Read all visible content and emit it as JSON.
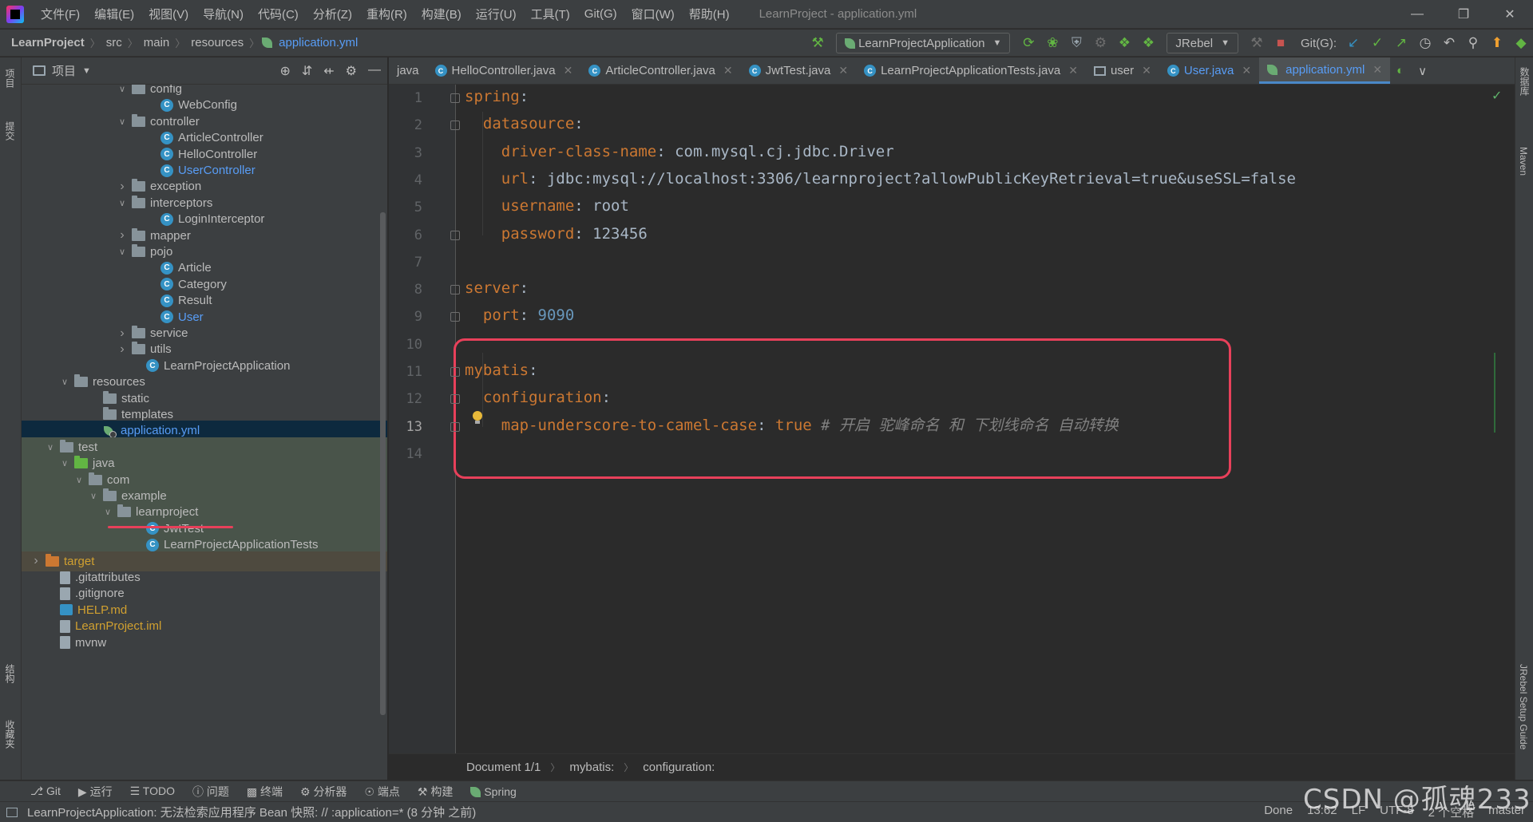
{
  "menu": {
    "items": [
      "文件(F)",
      "编辑(E)",
      "视图(V)",
      "导航(N)",
      "代码(C)",
      "分析(Z)",
      "重构(R)",
      "构建(B)",
      "运行(U)",
      "工具(T)",
      "Git(G)",
      "窗口(W)",
      "帮助(H)"
    ],
    "window_title": "LearnProject - application.yml"
  },
  "navbar": {
    "crumbs": [
      "LearnProject",
      "src",
      "main",
      "resources",
      "application.yml"
    ],
    "run_config": "LearnProjectApplication",
    "jrebel": "JRebel",
    "git_label": "Git(G):"
  },
  "project_panel": {
    "title": "项目"
  },
  "tree": [
    {
      "label": "config",
      "indent": 7,
      "expanded": true,
      "icon": "folder"
    },
    {
      "label": "WebConfig",
      "indent": 9,
      "icon": "class"
    },
    {
      "label": "controller",
      "indent": 7,
      "expanded": true,
      "icon": "folder"
    },
    {
      "label": "ArticleController",
      "indent": 9,
      "icon": "class"
    },
    {
      "label": "HelloController",
      "indent": 9,
      "icon": "class"
    },
    {
      "label": "UserController",
      "indent": 9,
      "icon": "class",
      "color": "blue"
    },
    {
      "label": "exception",
      "indent": 7,
      "expanded": false,
      "icon": "folder"
    },
    {
      "label": "interceptors",
      "indent": 7,
      "expanded": true,
      "icon": "folder"
    },
    {
      "label": "LoginInterceptor",
      "indent": 9,
      "icon": "class"
    },
    {
      "label": "mapper",
      "indent": 7,
      "expanded": false,
      "icon": "folder"
    },
    {
      "label": "pojo",
      "indent": 7,
      "expanded": true,
      "icon": "folder"
    },
    {
      "label": "Article",
      "indent": 9,
      "icon": "class"
    },
    {
      "label": "Category",
      "indent": 9,
      "icon": "class"
    },
    {
      "label": "Result",
      "indent": 9,
      "icon": "class"
    },
    {
      "label": "User",
      "indent": 9,
      "icon": "class",
      "color": "blue"
    },
    {
      "label": "service",
      "indent": 7,
      "expanded": false,
      "icon": "folder"
    },
    {
      "label": "utils",
      "indent": 7,
      "expanded": false,
      "icon": "folder"
    },
    {
      "label": "LearnProjectApplication",
      "indent": 8,
      "icon": "spring-class"
    },
    {
      "label": "resources",
      "indent": 3,
      "expanded": true,
      "icon": "folder"
    },
    {
      "label": "static",
      "indent": 5,
      "icon": "folder"
    },
    {
      "label": "templates",
      "indent": 5,
      "icon": "folder"
    },
    {
      "label": "application.yml",
      "indent": 5,
      "icon": "spring",
      "selected": true
    },
    {
      "label": "test",
      "indent": 2,
      "expanded": true,
      "icon": "folder",
      "bg": "test"
    },
    {
      "label": "java",
      "indent": 3,
      "expanded": true,
      "icon": "folder-green",
      "bg": "test"
    },
    {
      "label": "com",
      "indent": 4,
      "expanded": true,
      "icon": "folder",
      "bg": "test"
    },
    {
      "label": "example",
      "indent": 5,
      "expanded": true,
      "icon": "folder",
      "bg": "test"
    },
    {
      "label": "learnproject",
      "indent": 6,
      "expanded": true,
      "icon": "folder",
      "bg": "test"
    },
    {
      "label": "JwtTest",
      "indent": 8,
      "icon": "class",
      "bg": "test"
    },
    {
      "label": "LearnProjectApplicationTests",
      "indent": 8,
      "icon": "class",
      "bg": "test"
    },
    {
      "label": "target",
      "indent": 1,
      "expanded": false,
      "icon": "folder-orange",
      "color": "orange",
      "bg": "target"
    },
    {
      "label": ".gitattributes",
      "indent": 2,
      "icon": "file"
    },
    {
      "label": ".gitignore",
      "indent": 2,
      "icon": "file"
    },
    {
      "label": "HELP.md",
      "indent": 2,
      "icon": "md",
      "color": "orange"
    },
    {
      "label": "LearnProject.iml",
      "indent": 2,
      "icon": "file",
      "color": "orange"
    },
    {
      "label": "mvnw",
      "indent": 2,
      "icon": "file"
    }
  ],
  "tabs": [
    {
      "label": "java",
      "icon": "none"
    },
    {
      "label": "HelloController.java",
      "icon": "class"
    },
    {
      "label": "ArticleController.java",
      "icon": "class"
    },
    {
      "label": "JwtTest.java",
      "icon": "class"
    },
    {
      "label": "LearnProjectApplicationTests.java",
      "icon": "class"
    },
    {
      "label": "user",
      "icon": "table"
    },
    {
      "label": "User.java",
      "icon": "class",
      "color": "blue"
    },
    {
      "label": "application.yml",
      "icon": "spring",
      "active": true
    }
  ],
  "code_lines": [
    {
      "n": "1",
      "parts": [
        [
          "k",
          "spring"
        ],
        [
          "v",
          ":"
        ]
      ]
    },
    {
      "n": "2",
      "parts": [
        [
          "v",
          "  "
        ],
        [
          "k",
          "datasource"
        ],
        [
          "v",
          ":"
        ]
      ]
    },
    {
      "n": "3",
      "parts": [
        [
          "v",
          "    "
        ],
        [
          "k",
          "driver-class-name"
        ],
        [
          "v",
          ": com.mysql.cj.jdbc.Driver"
        ]
      ]
    },
    {
      "n": "4",
      "parts": [
        [
          "v",
          "    "
        ],
        [
          "k",
          "url"
        ],
        [
          "v",
          ": jdbc:mysql://localhost:3306/learnproject?allowPublicKeyRetrieval=true&useSSL=false"
        ]
      ]
    },
    {
      "n": "5",
      "parts": [
        [
          "v",
          "    "
        ],
        [
          "k",
          "username"
        ],
        [
          "v",
          ": root"
        ]
      ]
    },
    {
      "n": "6",
      "parts": [
        [
          "v",
          "    "
        ],
        [
          "k",
          "password"
        ],
        [
          "v",
          ": 123456"
        ]
      ]
    },
    {
      "n": "7",
      "parts": []
    },
    {
      "n": "8",
      "parts": [
        [
          "k",
          "server"
        ],
        [
          "v",
          ":"
        ]
      ]
    },
    {
      "n": "9",
      "parts": [
        [
          "v",
          "  "
        ],
        [
          "k",
          "port"
        ],
        [
          "v",
          ": "
        ],
        [
          "vb",
          "9090"
        ]
      ]
    },
    {
      "n": "10",
      "parts": []
    },
    {
      "n": "11",
      "parts": [
        [
          "k",
          "mybatis"
        ],
        [
          "v",
          ":"
        ]
      ]
    },
    {
      "n": "12",
      "parts": [
        [
          "v",
          "  "
        ],
        [
          "k",
          "configuration"
        ],
        [
          "v",
          ":"
        ]
      ]
    },
    {
      "n": "13",
      "parts": [
        [
          "v",
          "    "
        ],
        [
          "k",
          "map-underscore-to-camel-case"
        ],
        [
          "v",
          ": "
        ],
        [
          "k",
          "true"
        ],
        [
          "v",
          " "
        ],
        [
          "cm",
          "# 开启 驼峰命名 和 下划线命名 自动转换"
        ]
      ]
    },
    {
      "n": "14",
      "parts": []
    }
  ],
  "editor_breadcrumbs": [
    "Document 1/1",
    "mybatis:",
    "configuration:"
  ],
  "left_strip": [
    "项目",
    "提交",
    "结构",
    "收藏夹"
  ],
  "right_strip": [
    "数据库",
    "Maven",
    "JRebel Setup Guide"
  ],
  "toolwindows": [
    "Git",
    "运行",
    "TODO",
    "问题",
    "终端",
    "分析器",
    "端点",
    "构建",
    "Spring"
  ],
  "status": {
    "message": "LearnProjectApplication: 无法检索应用程序 Bean 快照: // :application=* (8 分钟 之前)",
    "right": [
      "Done",
      "13:62",
      "LF",
      "UTF-8",
      "2 个空格",
      "master"
    ]
  },
  "watermark": "CSDN @孤魂233",
  "colors": {
    "accent": "#589df6",
    "annotation": "#e8405a",
    "yaml_key": "#cc7832",
    "comment": "#808080"
  }
}
